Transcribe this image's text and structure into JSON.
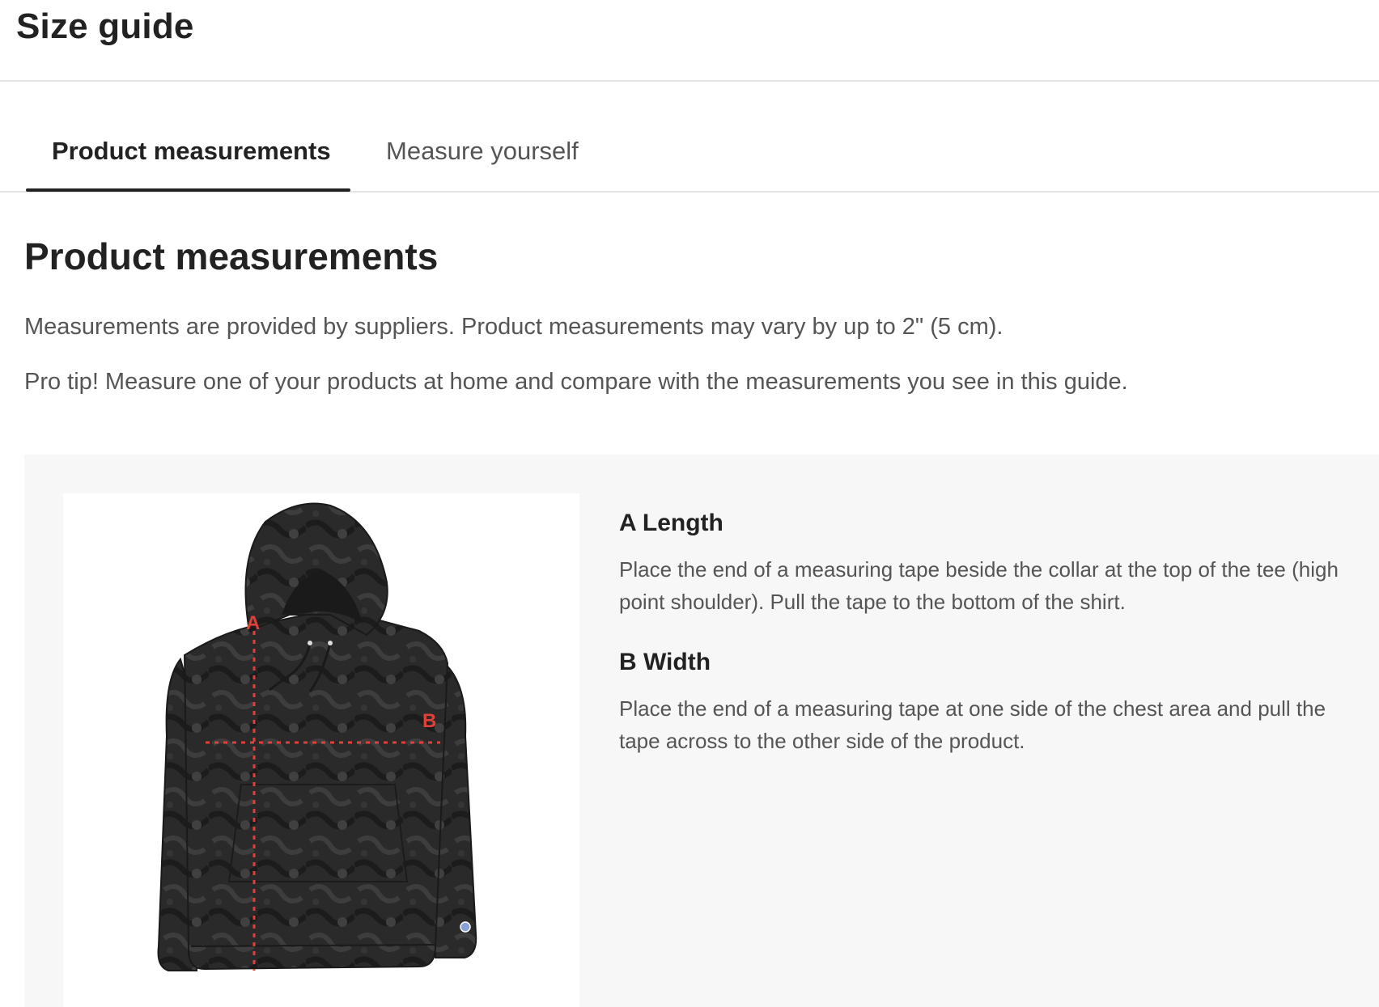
{
  "header": {
    "title": "Size guide"
  },
  "tabs": [
    {
      "label": "Product measurements",
      "active": true
    },
    {
      "label": "Measure yourself",
      "active": false
    }
  ],
  "content": {
    "title": "Product measurements",
    "paragraphs": [
      "Measurements are provided by suppliers. Product measurements may vary by up to 2\" (5 cm).",
      "Pro tip! Measure one of your products at home and compare with the measurements you see in this guide."
    ]
  },
  "diagram": {
    "image": "hoodie-product-image",
    "marker_a": "A",
    "marker_b": "B",
    "marker_color": "#e0403a"
  },
  "measurements": [
    {
      "title": "A Length",
      "description": "Place the end of a measuring tape beside the collar at the top of the tee (high point shoulder). Pull the tape to the bottom of the shirt."
    },
    {
      "title": "B Width",
      "description": "Place the end of a measuring tape at one side of the chest area and pull the tape across to the other side of the product."
    }
  ]
}
